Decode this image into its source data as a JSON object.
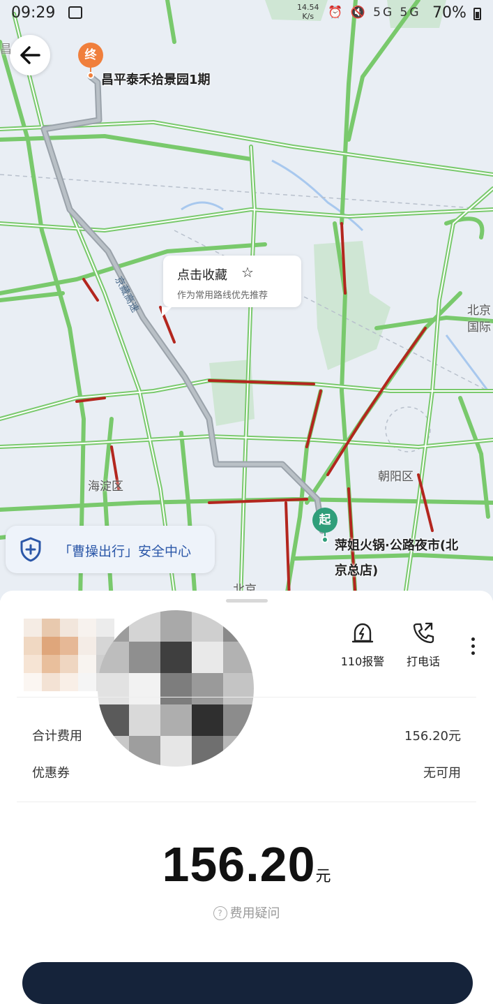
{
  "status_bar": {
    "time": "09:29",
    "net_speed_value": "14.54",
    "net_speed_unit": "K/s",
    "icons": "⏰ 🔇 5G 5G",
    "battery": "70%"
  },
  "map": {
    "destination": {
      "marker": "终",
      "name": "昌平泰禾拾景园1期"
    },
    "origin": {
      "marker": "起",
      "name": "萍姐火锅·公路夜市(北京总店)"
    },
    "favorite_tip": {
      "title": "点击收藏",
      "star": "☆",
      "subtitle": "作为常用路线优先推荐"
    },
    "labels": {
      "haidian": "海淀区",
      "chaoyang": "朝阳区",
      "beijing": "北京",
      "capital_airport_1": "北京",
      "capital_airport_2": "国际",
      "expressway": "京藏高速",
      "top_left": "昌"
    },
    "safety_center": "「曹操出行」安全中心",
    "colors": {
      "road": "#79c96c",
      "congestion": "#b3261e",
      "route": "#9aa2aa",
      "dest": "#f07f3c",
      "origin": "#2f9e7a"
    }
  },
  "sheet": {
    "actions": [
      {
        "icon": "alarm-icon",
        "label": "110报警"
      },
      {
        "icon": "phone-icon",
        "label": "打电话"
      }
    ],
    "fare_rows": [
      {
        "label": "合计费用",
        "value": "156.20元"
      },
      {
        "label": "优惠券",
        "value": "无可用"
      }
    ],
    "total": {
      "amount": "156.20",
      "unit": "元"
    },
    "fee_question": "费用疑问"
  }
}
